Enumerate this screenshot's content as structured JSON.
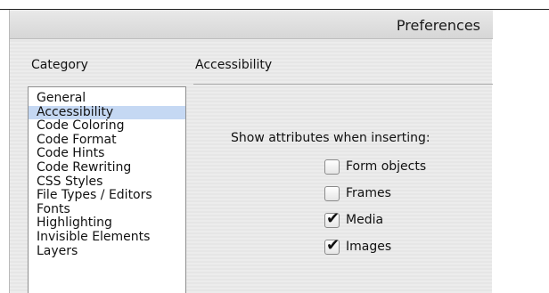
{
  "window": {
    "title": "Preferences"
  },
  "sidebar": {
    "heading": "Category",
    "items": [
      {
        "label": "General",
        "selected": false
      },
      {
        "label": "Accessibility",
        "selected": true
      },
      {
        "label": "Code Coloring",
        "selected": false
      },
      {
        "label": "Code Format",
        "selected": false
      },
      {
        "label": "Code Hints",
        "selected": false
      },
      {
        "label": "Code Rewriting",
        "selected": false
      },
      {
        "label": "CSS Styles",
        "selected": false
      },
      {
        "label": "File Types / Editors",
        "selected": false
      },
      {
        "label": "Fonts",
        "selected": false
      },
      {
        "label": "Highlighting",
        "selected": false
      },
      {
        "label": "Invisible Elements",
        "selected": false
      },
      {
        "label": "Layers",
        "selected": false
      }
    ]
  },
  "panel": {
    "heading": "Accessibility",
    "show_attributes_label": "Show attributes when inserting:",
    "options": [
      {
        "label": "Form objects",
        "checked": false
      },
      {
        "label": "Frames",
        "checked": false
      },
      {
        "label": "Media",
        "checked": true
      },
      {
        "label": "Images",
        "checked": true
      }
    ]
  },
  "colors": {
    "selection": "#c5d8f3",
    "window_background": "#ececec"
  }
}
